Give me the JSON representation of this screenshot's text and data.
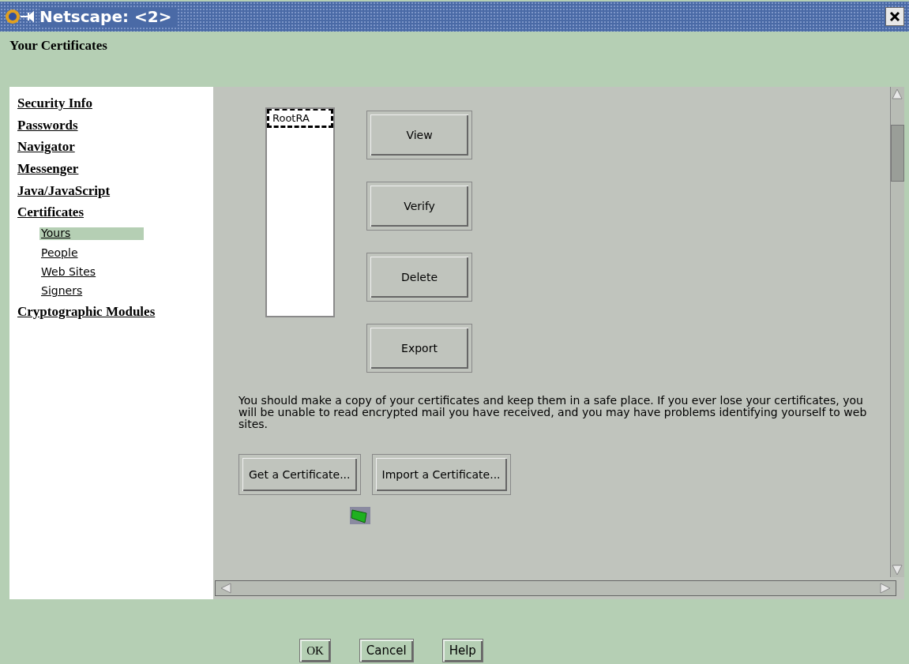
{
  "window": {
    "title": "Netscape: <2>"
  },
  "header": {
    "title": "Your Certificates"
  },
  "sidebar": {
    "items": [
      {
        "label": "Security Info",
        "selected": false
      },
      {
        "label": "Passwords",
        "selected": false
      },
      {
        "label": "Navigator",
        "selected": false
      },
      {
        "label": "Messenger",
        "selected": false
      },
      {
        "label": "Java/JavaScript",
        "selected": false
      },
      {
        "label": "Certificates",
        "selected": false,
        "children": [
          {
            "label": "Yours",
            "selected": true
          },
          {
            "label": "People",
            "selected": false
          },
          {
            "label": "Web Sites",
            "selected": false
          },
          {
            "label": "Signers",
            "selected": false
          }
        ]
      },
      {
        "label": "Cryptographic Modules",
        "selected": false
      }
    ]
  },
  "certificates": {
    "items": [
      {
        "label": "RootRA",
        "selected": true
      }
    ]
  },
  "actions": [
    "View",
    "Verify",
    "Delete",
    "Export"
  ],
  "note": "You should make a copy of your certificates and keep them in a safe place. If you ever lose your certificates, you will be unable to read encrypted mail you have received, and you may have problems identifying yourself to web sites.",
  "bottom_buttons": [
    "Get a Certificate...",
    "Import a Certificate..."
  ],
  "dialog_buttons": [
    "OK",
    "Cancel",
    "Help"
  ]
}
